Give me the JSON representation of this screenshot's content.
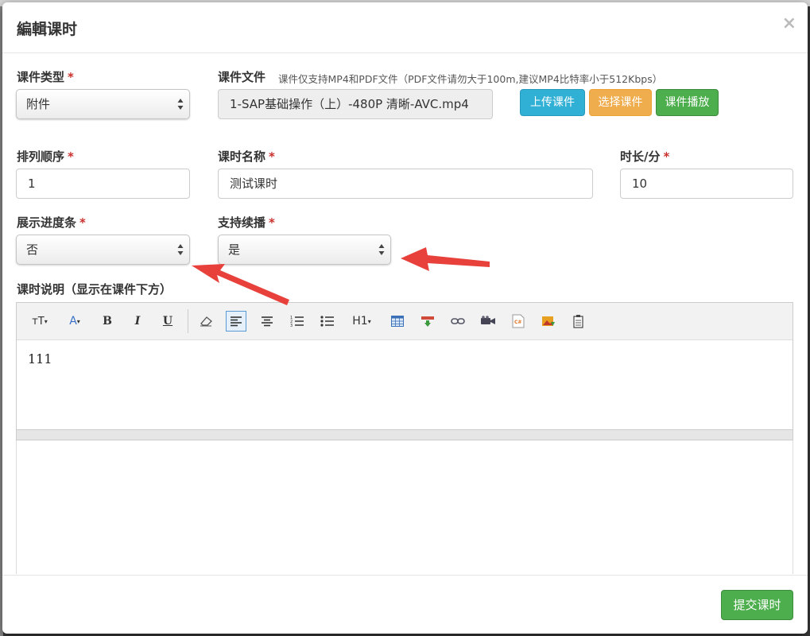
{
  "modal": {
    "title": "編輯课时",
    "close_symbol": "×"
  },
  "form": {
    "course_type": {
      "label": "课件类型",
      "value": "附件"
    },
    "course_file": {
      "label": "课件文件",
      "hint": "课件仅支持MP4和PDF文件（PDF文件请勿大于100m,建议MP4比特率小于512Kbps）",
      "value": "1-SAP基础操作（上）-480P 清晰-AVC.mp4"
    },
    "buttons": {
      "upload": "上传课件",
      "select": "选择课件",
      "play": "课件播放"
    },
    "sort_order": {
      "label": "排列顺序",
      "value": "1"
    },
    "lesson_name": {
      "label": "课时名称",
      "value": "测试课时"
    },
    "duration": {
      "label": "时长/分",
      "value": "10"
    },
    "show_progress": {
      "label": "展示进度条",
      "value": "否"
    },
    "support_resume": {
      "label": "支持续播",
      "value": "是"
    },
    "description": {
      "label": "课时说明（显示在课件下方）",
      "content": "111"
    },
    "required_mark": "*"
  },
  "toolbar": {
    "font_size": "тT",
    "font_color": "A",
    "bold": "B",
    "italic": "I",
    "underline": "U",
    "heading": "H1"
  },
  "footer": {
    "submit": "提交课时"
  },
  "colors": {
    "required": "#c9302c",
    "info": "#31b0d5",
    "warning": "#f0ad4e",
    "success": "#4cae4c",
    "annotation_arrow": "#e8413c"
  }
}
